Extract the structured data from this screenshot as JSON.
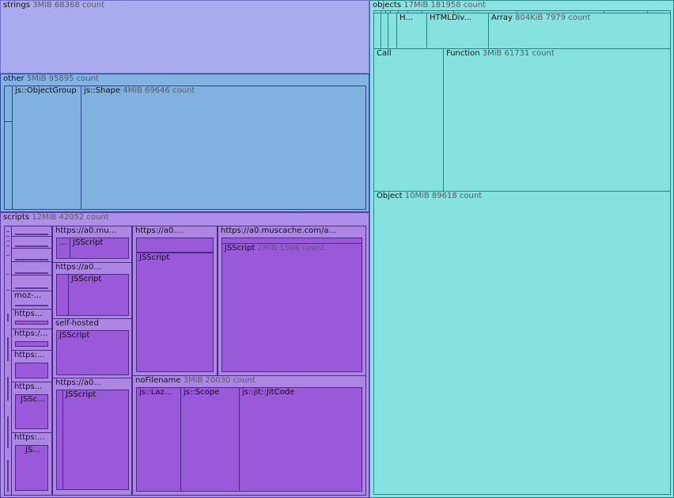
{
  "colors": {
    "strings": "#aaaaef",
    "other": "#83b3e3",
    "scripts": "#ae8fe7",
    "objects": "#8ae3e2"
  },
  "strings": {
    "name": "strings",
    "meta": "3MiB 68368 count"
  },
  "other": {
    "name": "other",
    "meta": "5MiB 95895 count",
    "children": [
      {
        "name": "js::ObjectGroup",
        "meta": ""
      },
      {
        "name": "js::Shape",
        "meta": "4MiB 69646 count"
      }
    ]
  },
  "scripts": {
    "name": "scripts",
    "meta": "12MiB 42052 count",
    "small_labels": [
      "moz-...",
      "https...",
      "https:/...",
      "https:...",
      "https...",
      "https:..."
    ],
    "small_inner": [
      "JSSc...",
      "JS..."
    ],
    "groups": [
      {
        "name": "https://a0.mu...",
        "inner_small": "...",
        "inner": "JSScript"
      },
      {
        "name": "https://a0...",
        "inner": "JSScript"
      },
      {
        "name": "self-hosted",
        "inner": "JSScript"
      },
      {
        "name": "https://a0...",
        "inner": "JSScript"
      },
      {
        "name": "https://a0....",
        "inner": "JSScript"
      },
      {
        "name": "https://a0.muscache.com/a...",
        "inner": "JSScript",
        "inner_meta": "2MiB 1508 count"
      }
    ],
    "nofilename": {
      "name": "noFilename",
      "meta": "3MiB 20030 count",
      "children": [
        "js::Laz...",
        "js::Scope",
        "js::jit::JitCode"
      ]
    }
  },
  "objects": {
    "name": "objects",
    "meta": "17MiB 181958 count",
    "top": [
      {
        "name": "H..."
      },
      {
        "name": "HTMLDiv..."
      },
      {
        "name": "Array",
        "meta": "804KiB 7979 count"
      }
    ],
    "call": {
      "name": "Call"
    },
    "function": {
      "name": "Function",
      "meta": "3MiB 61731 count"
    },
    "object": {
      "name": "Object",
      "meta": "10MiB 89618 count"
    }
  }
}
